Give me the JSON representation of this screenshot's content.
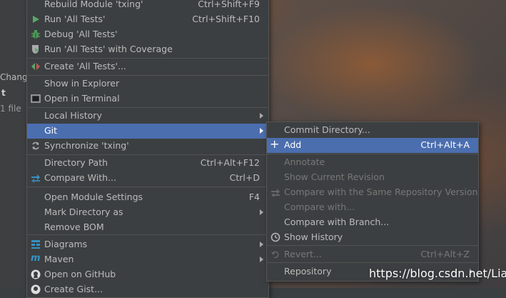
{
  "left_panel": {
    "line1": "Change",
    "line2": "t",
    "line3": "1 file"
  },
  "main_menu": {
    "items": [
      {
        "label": "Rebuild Module 'txing'",
        "shortcut": "Ctrl+Shift+F9",
        "icon": ""
      },
      {
        "label": "Run 'All Tests'",
        "shortcut": "Ctrl+Shift+F10",
        "icon": "run-icon"
      },
      {
        "label": "Debug 'All Tests'",
        "shortcut": "",
        "icon": "debug-icon"
      },
      {
        "label": "Run 'All Tests' with Coverage",
        "shortcut": "",
        "icon": "coverage-icon"
      },
      {
        "label": "Create 'All Tests'...",
        "shortcut": "",
        "icon": "create-test-icon"
      },
      {
        "label": "Show in Explorer",
        "shortcut": "",
        "icon": ""
      },
      {
        "label": "Open in Terminal",
        "shortcut": "",
        "icon": "terminal-icon"
      },
      {
        "label": "Local History",
        "shortcut": "",
        "icon": ""
      },
      {
        "label": "Git",
        "shortcut": "",
        "icon": ""
      },
      {
        "label": "Synchronize 'txing'",
        "shortcut": "",
        "icon": "sync-icon"
      },
      {
        "label": "Directory Path",
        "shortcut": "Ctrl+Alt+F12",
        "icon": ""
      },
      {
        "label": "Compare With...",
        "shortcut": "Ctrl+D",
        "icon": "compare-icon"
      },
      {
        "label": "Open Module Settings",
        "shortcut": "F4",
        "icon": ""
      },
      {
        "label": "Mark Directory as",
        "shortcut": "",
        "icon": ""
      },
      {
        "label": "Remove BOM",
        "shortcut": "",
        "icon": ""
      },
      {
        "label": "Diagrams",
        "shortcut": "",
        "icon": "diagrams-icon"
      },
      {
        "label": "Maven",
        "shortcut": "",
        "icon": "maven-icon"
      },
      {
        "label": "Open on GitHub",
        "shortcut": "",
        "icon": "github-icon"
      },
      {
        "label": "Create Gist...",
        "shortcut": "",
        "icon": "github-icon"
      }
    ]
  },
  "git_submenu": {
    "items": [
      {
        "label": "Commit Directory...",
        "shortcut": "",
        "state": "enabled"
      },
      {
        "label": "Add",
        "shortcut": "Ctrl+Alt+A",
        "state": "selected"
      },
      {
        "label": "Annotate",
        "shortcut": "",
        "state": "disabled"
      },
      {
        "label": "Show Current Revision",
        "shortcut": "",
        "state": "disabled"
      },
      {
        "label": "Compare with the Same Repository Version",
        "shortcut": "",
        "state": "disabled"
      },
      {
        "label": "Compare with...",
        "shortcut": "",
        "state": "disabled"
      },
      {
        "label": "Compare with Branch...",
        "shortcut": "",
        "state": "enabled"
      },
      {
        "label": "Show History",
        "shortcut": "",
        "state": "enabled"
      },
      {
        "label": "Revert...",
        "shortcut": "Ctrl+Alt+Z",
        "state": "disabled"
      },
      {
        "label": "Repository",
        "shortcut": "",
        "state": "enabled"
      }
    ]
  },
  "watermark": "https://blog.csdn.net/Liar_",
  "colors": {
    "menu_bg": "#3c3f41",
    "selection": "#4b6eaf",
    "text": "#bbbbbb",
    "disabled_text": "#777777",
    "run_green": "#59a869",
    "debug_green": "#499c54",
    "github_white": "#dddddd",
    "maven_blue": "#3592c4"
  }
}
